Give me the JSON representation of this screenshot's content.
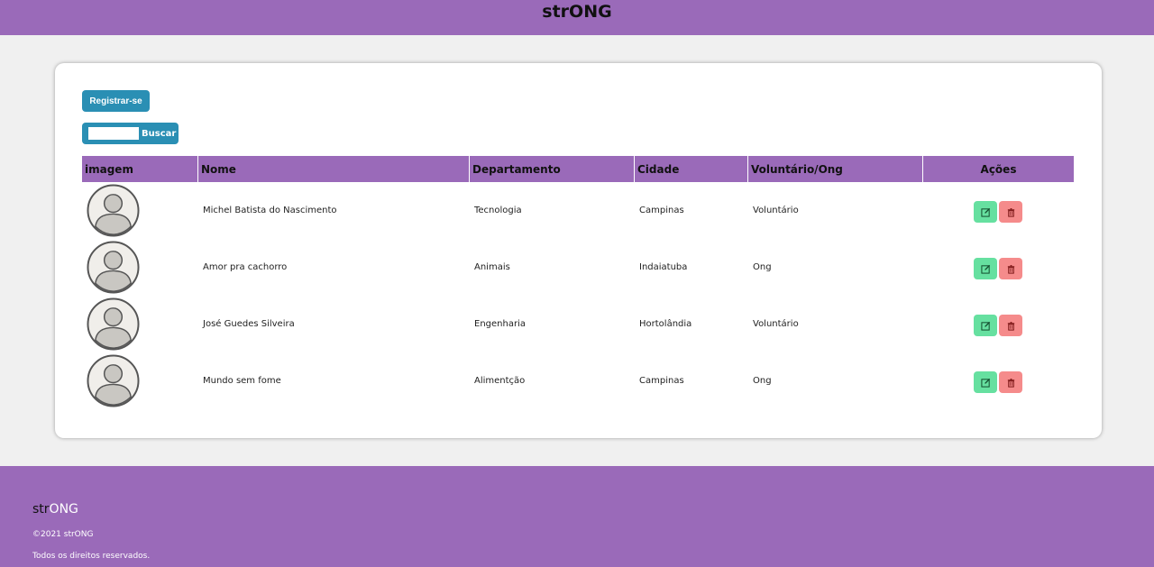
{
  "header": {
    "brand": "strONG"
  },
  "toolbar": {
    "register_label": "Registrar-se",
    "search_label": "Buscar",
    "search_value": ""
  },
  "table": {
    "headers": [
      "imagem",
      "Nome",
      "Departamento",
      "Cidade",
      "Voluntário/Ong",
      "Ações"
    ],
    "rows": [
      {
        "nome": "Michel Batista do Nascimento",
        "departamento": "Tecnologia",
        "cidade": "Campinas",
        "tipo": "Voluntário"
      },
      {
        "nome": "Amor pra cachorro",
        "departamento": "Animais",
        "cidade": "Indaiatuba",
        "tipo": "Ong"
      },
      {
        "nome": "José Guedes Silveira",
        "departamento": "Engenharia",
        "cidade": "Hortolândia",
        "tipo": "Voluntário"
      },
      {
        "nome": "Mundo sem fome",
        "departamento": "Alimentção",
        "cidade": "Campinas",
        "tipo": "Ong"
      }
    ]
  },
  "icons": {
    "avatar": "user-avatar-icon",
    "edit": "edit-icon",
    "delete": "trash-icon"
  },
  "colors": {
    "brand": "#9a6ab9",
    "button": "#2a8fb4",
    "edit": "#66e0a0",
    "delete": "#f58b8b"
  },
  "footer": {
    "brand_dark": "str",
    "brand_light": "ONG",
    "copyright": "©2021 strONG",
    "rights": "Todos os direitos reservados."
  }
}
